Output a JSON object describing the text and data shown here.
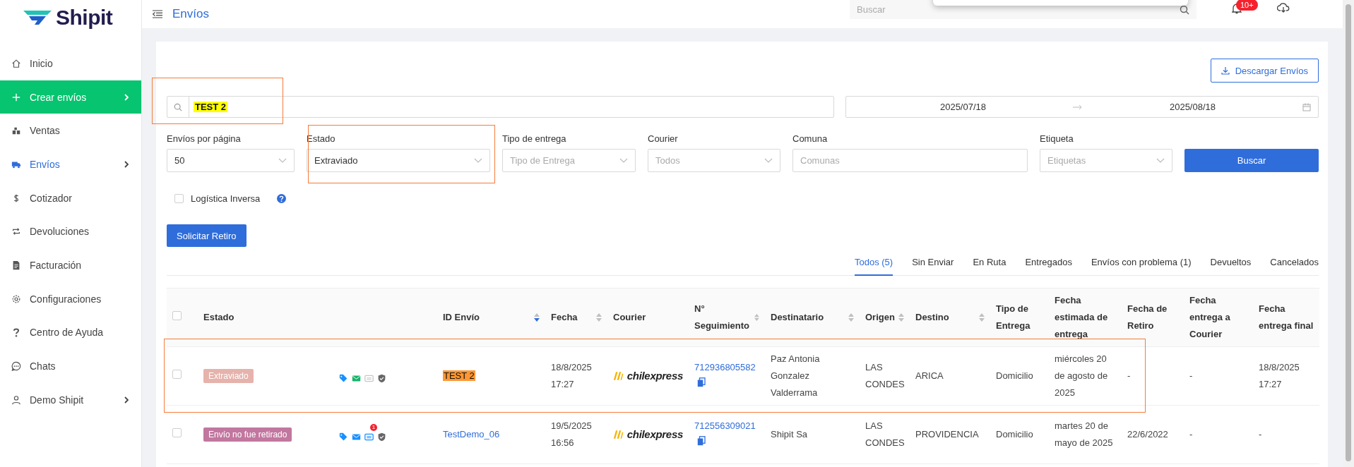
{
  "sidebar": {
    "logo": "Shipit",
    "items": [
      {
        "label": "Inicio",
        "kind": "link",
        "selected": false,
        "expandable": false
      },
      {
        "label": "Crear envíos",
        "kind": "action",
        "selected": false,
        "expandable": true
      },
      {
        "label": "Ventas",
        "kind": "link",
        "selected": false,
        "expandable": false
      },
      {
        "label": "Envíos",
        "kind": "link",
        "selected": true,
        "expandable": true
      },
      {
        "label": "Cotizador",
        "kind": "link",
        "selected": false,
        "expandable": false
      },
      {
        "label": "Devoluciones",
        "kind": "link",
        "selected": false,
        "expandable": false
      },
      {
        "label": "Facturación",
        "kind": "link",
        "selected": false,
        "expandable": false
      },
      {
        "label": "Configuraciones",
        "kind": "link",
        "selected": false,
        "expandable": false
      },
      {
        "label": "Centro de Ayuda",
        "kind": "link",
        "selected": false,
        "expandable": false
      },
      {
        "label": "Chats",
        "kind": "link",
        "selected": false,
        "expandable": false
      },
      {
        "label": "Demo Shipit",
        "kind": "link",
        "selected": false,
        "expandable": true
      }
    ]
  },
  "topbar": {
    "title": "Envíos",
    "search": {
      "placeholder": "Buscar"
    },
    "notification_badge": "10+"
  },
  "download_button": "Descargar Envíos",
  "search": {
    "value": "TEST 2",
    "highlighted": true
  },
  "date_range": {
    "start": "2025/07/18",
    "end": "2025/08/18"
  },
  "filters": [
    {
      "label": "Envíos por página",
      "kind": "select",
      "value": "50"
    },
    {
      "label": "Estado",
      "kind": "select",
      "value": "Extraviado"
    },
    {
      "label": "Tipo de entrega",
      "kind": "select",
      "placeholder": "Tipo de Entrega"
    },
    {
      "label": "Courier",
      "kind": "select",
      "placeholder": "Todos"
    },
    {
      "label": "Comuna",
      "kind": "input",
      "placeholder": "Comunas"
    },
    {
      "label": "Etiqueta",
      "kind": "select",
      "placeholder": "Etiquetas"
    }
  ],
  "search_button": "Buscar",
  "reverse_logistics": {
    "label": "Logística Inversa",
    "checked": false
  },
  "pickup_button": "Solicitar Retiro",
  "tabs": [
    {
      "label": "Todos (5)",
      "selected": true
    },
    {
      "label": "Sin Enviar",
      "selected": false
    },
    {
      "label": "En Ruta",
      "selected": false
    },
    {
      "label": "Entregados",
      "selected": false
    },
    {
      "label": "Envíos con problema (1)",
      "selected": false
    },
    {
      "label": "Devueltos",
      "selected": false
    },
    {
      "label": "Cancelados",
      "selected": false
    }
  ],
  "table": {
    "all_checked": false,
    "columns": [
      {
        "kind": "text",
        "label": "Estado"
      },
      {
        "kind": "icons"
      },
      {
        "kind": "text",
        "label": "ID Envío",
        "sortable": true,
        "sorted_descending": true
      },
      {
        "kind": "text",
        "label": "Fecha",
        "sortable": true,
        "sorted_descending": false
      },
      {
        "kind": "text",
        "label": "Courier"
      },
      {
        "kind": "text",
        "label": "N° Seguimiento",
        "sortable": true,
        "sorted_descending": false
      },
      {
        "kind": "text",
        "label": "Destinatario",
        "sortable": true,
        "sorted_descending": false
      },
      {
        "kind": "text",
        "label": "Origen",
        "sortable": true,
        "sorted_descending": false
      },
      {
        "kind": "text",
        "label": "Destino",
        "sortable": true,
        "sorted_descending": false
      },
      {
        "kind": "text",
        "label": "Tipo de Entrega"
      },
      {
        "kind": "text",
        "label": "Fecha estimada de entrega"
      },
      {
        "kind": "text",
        "label": "Fecha de Retiro"
      },
      {
        "kind": "text",
        "label": "Fecha entrega a Courier"
      },
      {
        "kind": "text",
        "label": "Fecha entrega final"
      }
    ],
    "rows": [
      {
        "checked": false,
        "status": {
          "label": "Extraviado",
          "color": "#e6b2ac"
        },
        "icons": [
          {
            "kind": "tag",
            "color": "#1890ff"
          },
          {
            "kind": "mail",
            "color": "#18b36a"
          },
          {
            "kind": "ticket",
            "color": "#c8c8c8"
          },
          {
            "kind": "shield",
            "color": "#666666"
          }
        ],
        "id": "TEST 2",
        "id_highlighted": true,
        "date": "18/8/2025 17:27",
        "courier": "chilexpress",
        "tracking": "712936805582",
        "recipient": "Paz Antonia Gonzalez Valderrama",
        "origin": "LAS CONDES",
        "destination": "ARICA",
        "delivery_type": "Domicilio",
        "estimated_date": "miércoles 20 de agosto de 2025",
        "pickup_date": "-",
        "courier_date": "-",
        "final_date": "18/8/2025 17:27"
      },
      {
        "checked": false,
        "status": {
          "label": "Envío no fue retirado",
          "color": "#c2779f"
        },
        "icons": [
          {
            "kind": "tag",
            "color": "#1890ff"
          },
          {
            "kind": "mail",
            "color": "#1890ff"
          },
          {
            "kind": "ticket",
            "color": "#1890ff",
            "badge": "1"
          },
          {
            "kind": "shield",
            "color": "#666666"
          }
        ],
        "id": "TestDemo_06",
        "id_highlighted": false,
        "date": "19/5/2025 16:56",
        "courier": "chilexpress",
        "tracking": "712556309021",
        "recipient": "Shipit Sa",
        "origin": "LAS CONDES",
        "destination": "PROVIDENCIA",
        "delivery_type": "Domicilio",
        "estimated_date": "martes 20 de mayo de 2025",
        "pickup_date": "22/6/2022",
        "courier_date": "-",
        "final_date": "-"
      }
    ]
  }
}
